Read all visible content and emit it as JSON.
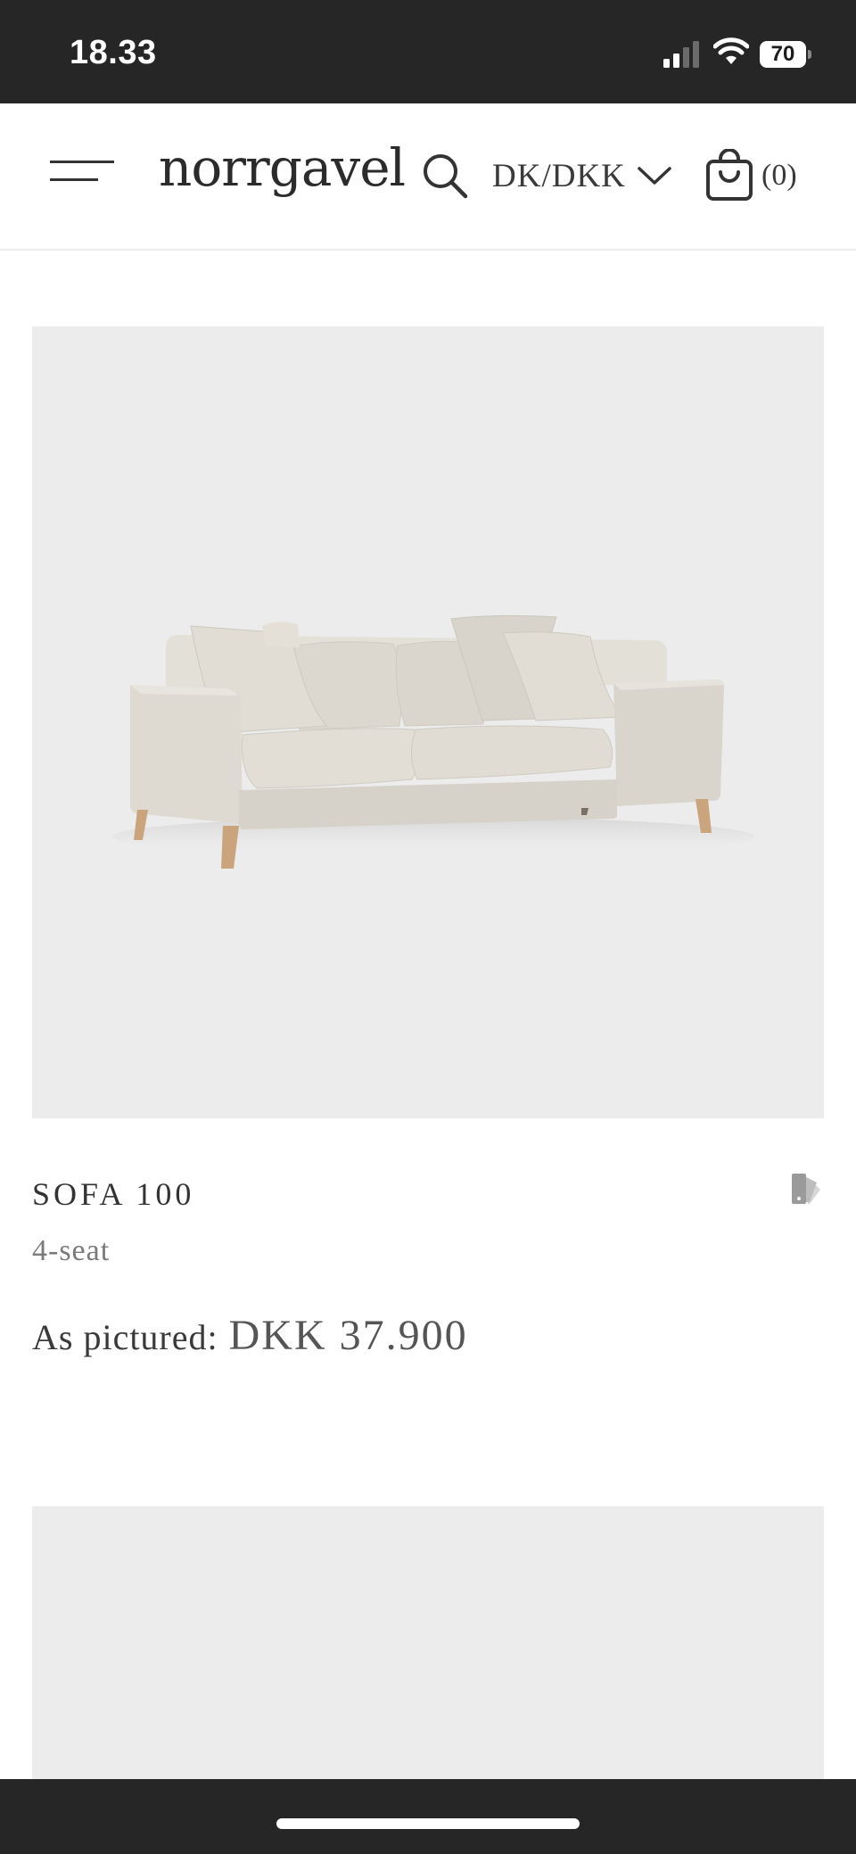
{
  "status_bar": {
    "time": "18.33",
    "battery_level": "70",
    "signal_icon": "cellular-signal-icon",
    "wifi_icon": "wifi-icon"
  },
  "header": {
    "brand": "norrgavel",
    "menu_icon": "hamburger-menu-icon",
    "search_icon": "search-icon",
    "region": "DK/DKK",
    "cart_count": "(0)"
  },
  "products": [
    {
      "image_icon": "sofa-image",
      "title": "SOFA 100",
      "variant": "4-seat",
      "price_label": "As pictured:",
      "price": "DKK 37.900",
      "swatch_icon": "fabric-swatch-icon"
    }
  ],
  "colors": {
    "status_bar_bg": "#262626",
    "image_bg": "#ececec",
    "text": "#3a3a3a",
    "muted_text": "#7a7a7a",
    "sofa_fabric": "#ddd9d0",
    "sofa_legs": "#c9a47c"
  }
}
